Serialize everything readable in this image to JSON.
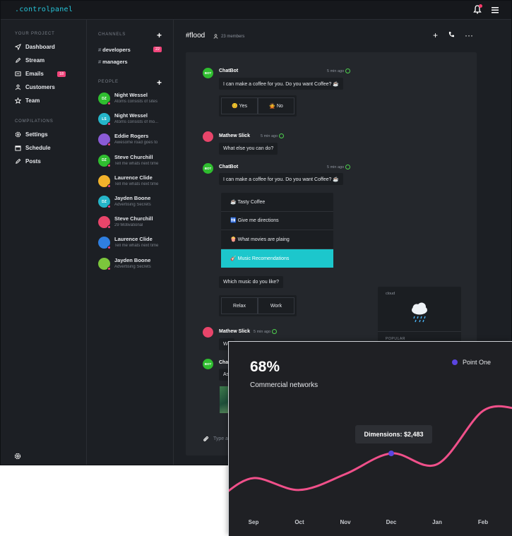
{
  "app": {
    "logo": ".controlpanel",
    "nav": {
      "project_title": "YOUR PROJECT",
      "items": [
        {
          "label": "Dashboard",
          "icon": "send-icon"
        },
        {
          "label": "Stream",
          "icon": "pen-icon"
        },
        {
          "label": "Emails",
          "icon": "mail-icon",
          "badge": "18"
        },
        {
          "label": "Customers",
          "icon": "users-icon"
        },
        {
          "label": "Team",
          "icon": "star-icon"
        }
      ],
      "compilations_title": "COMPILATIONS",
      "compilations": [
        {
          "label": "Settings",
          "icon": "gear-icon"
        },
        {
          "label": "Schedule",
          "icon": "calendar-icon"
        },
        {
          "label": "Posts",
          "icon": "pen-icon"
        }
      ]
    },
    "channels": {
      "title": "CHANNELS",
      "items": [
        {
          "label": "developers",
          "badge": "22"
        },
        {
          "label": "managers"
        }
      ],
      "people_title": "PEOPLE",
      "people": [
        {
          "name": "Night Wessel",
          "msg": "Atoms consists of sites",
          "initials": "DZ",
          "color": "#2fbd2f"
        },
        {
          "name": "Night Wessel",
          "msg": "Atoms consists of mo...",
          "initials": "LS",
          "color": "#25b5c9"
        },
        {
          "name": "Eddie Rogers",
          "msg": "Awesome road goes to",
          "initials": "",
          "color": "#8a5bd6"
        },
        {
          "name": "Steve Churchill",
          "msg": "Tell me whats next time",
          "initials": "DZ",
          "color": "#2fbd2f"
        },
        {
          "name": "Laurence Clide",
          "msg": "Tell me whats next time",
          "initials": "",
          "color": "#f2b22b"
        },
        {
          "name": "Jayden Boone",
          "msg": "Advertising Secrets",
          "initials": "DZ",
          "color": "#25b5c9"
        },
        {
          "name": "Steve Churchill",
          "msg": "29 Motivational",
          "initials": "",
          "color": "#e8456a"
        },
        {
          "name": "Laurence Clide",
          "msg": "Tell me whats next time",
          "initials": "",
          "color": "#2f7fe0"
        },
        {
          "name": "Jayden Boone",
          "msg": "Advertising Secrets",
          "initials": "",
          "color": "#7cc63c"
        }
      ]
    },
    "chat": {
      "channel": "#flood",
      "members": "23 members",
      "messages": {
        "m1_name": "ChatBot",
        "m1_time": "5 min ago",
        "m1_text": "I can make a coffee for you. Do you want Coffee? ☕",
        "yes": "😊 Yes",
        "no": "🙅 No",
        "m2_name": "Mathew Slick",
        "m2_time": "5 min ago",
        "m2_text": "What else you can do?",
        "m3_name": "ChatBot",
        "m3_time": "5 min ago",
        "m3_text": "I can make a coffee for you. Do you want Coffee? ☕",
        "menu": [
          "☕ Tasty Coffee",
          "🚻 Give me directions",
          "🍿 What movies are plaing",
          "🎸 Music Recomendations"
        ],
        "m4_text": "Which music do you like?",
        "relax": "Relax",
        "work": "Work",
        "m5_name": "Mathew Slick",
        "m5_time": "5 min ago",
        "m5_text": "Wo",
        "m6_name": "Chat",
        "m6_text": "As",
        "bot_label": "BOT"
      },
      "weather": {
        "label": "cloud",
        "popular": "POPULAR"
      },
      "composer_placeholder": "Type a"
    }
  },
  "card": {
    "value": "68%",
    "subtitle": "Commercial networks",
    "legend": "Point One",
    "tooltip": "Dimensions: $2,483",
    "accent": "#f0508a",
    "point_color": "#5b45e0"
  },
  "chart_data": {
    "type": "line",
    "categories": [
      "Sep",
      "Oct",
      "Nov",
      "Dec",
      "Jan",
      "Feb"
    ],
    "series": [
      {
        "name": "Point One",
        "values": [
          30,
          18,
          34,
          55,
          44,
          98
        ]
      }
    ],
    "highlight": {
      "category": "Dec",
      "label": "Dimensions: $2,483"
    },
    "ylim": [
      0,
      100
    ],
    "title": "68%",
    "subtitle": "Commercial networks"
  }
}
